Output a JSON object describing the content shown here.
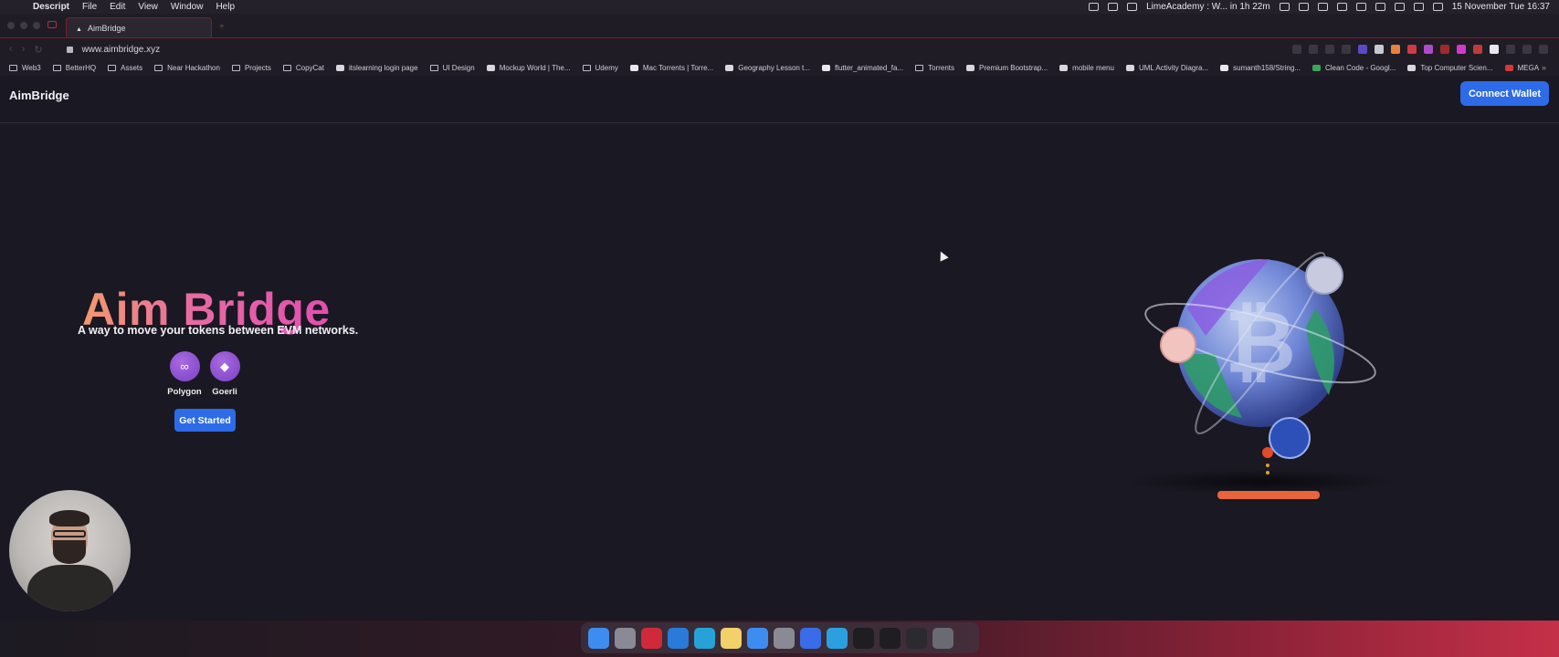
{
  "menubar": {
    "app_name": "Descript",
    "menus": [
      "File",
      "Edit",
      "View",
      "Window",
      "Help"
    ],
    "status_text": "LimeAcademy : W... in 1h 22m",
    "datetime": "15 November Tue  16:37"
  },
  "browser": {
    "tab_title": "AimBridge",
    "url": "www.aimbridge.xyz",
    "bookmarks": [
      {
        "label": "Web3",
        "icon": "folder-icon"
      },
      {
        "label": "BetterHQ",
        "icon": "folder-icon"
      },
      {
        "label": "Assets",
        "icon": "folder-icon"
      },
      {
        "label": "Near Hackathon",
        "icon": "folder-icon"
      },
      {
        "label": "Projects",
        "icon": "folder-icon"
      },
      {
        "label": "CopyCat",
        "icon": "folder-icon"
      },
      {
        "label": "itslearning login page",
        "icon": "site-icon"
      },
      {
        "label": "UI Design",
        "icon": "folder-icon"
      },
      {
        "label": "Mockup World | The...",
        "icon": "site-icon"
      },
      {
        "label": "Udemy",
        "icon": "folder-icon"
      },
      {
        "label": "Mac Torrents | Torre...",
        "icon": "page-icon"
      },
      {
        "label": "Geography Lesson t...",
        "icon": "site-icon"
      },
      {
        "label": "flutter_animated_fa...",
        "icon": "github-icon"
      },
      {
        "label": "Torrents",
        "icon": "folder-icon"
      },
      {
        "label": "Premium Bootstrap...",
        "icon": "site-icon"
      },
      {
        "label": "mobile menu",
        "icon": "site-icon"
      },
      {
        "label": "UML Activity Diagra...",
        "icon": "site-icon"
      },
      {
        "label": "sumanth158/String...",
        "icon": "github-icon"
      },
      {
        "label": "Clean Code - Googl...",
        "icon": "drive-icon"
      },
      {
        "label": "Top Computer Scien...",
        "icon": "site-icon"
      },
      {
        "label": "MEGA",
        "icon": "mega-icon"
      }
    ]
  },
  "page": {
    "brand": "AimBridge",
    "connect_wallet": "Connect Wallet",
    "hero_title": "Aim Bridge",
    "hero_subtitle": "A way to move your tokens between EVM networks.",
    "networks": [
      {
        "label": "Polygon",
        "icon": "polygon-icon"
      },
      {
        "label": "Goerli",
        "icon": "ethereum-icon"
      }
    ],
    "get_started": "Get Started"
  },
  "colors": {
    "accent": "#2d6be8",
    "background": "#1a1822",
    "title_gradient": [
      "#f29a6b",
      "#e14fb0"
    ],
    "network_coin": "#8a4fd0"
  },
  "dock_apps": [
    "finder-icon",
    "launchpad-icon",
    "opera-icon",
    "vscode-icon",
    "app-icon",
    "notes-icon",
    "appstore-icon",
    "settings-icon",
    "descript-icon",
    "telegram-icon",
    "terminal-icon",
    "activity-monitor-icon",
    "window-icon",
    "trash-icon"
  ]
}
